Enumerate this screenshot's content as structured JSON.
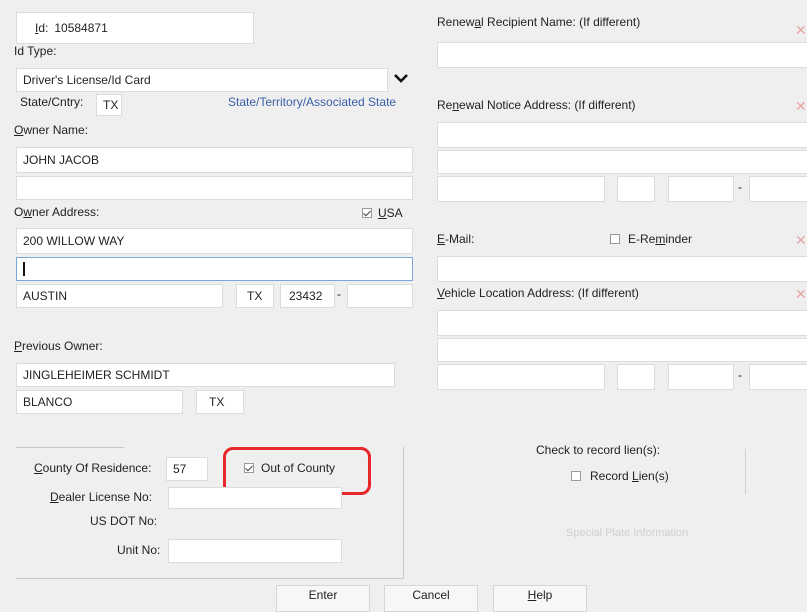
{
  "left": {
    "id_label": "Id:",
    "id_value": "10584871",
    "id_type_label": "Id Type:",
    "id_type_value": "Driver's License/Id Card",
    "state_label": "State/Cntry:",
    "state_value": "TX",
    "state_link": "State/Territory/Associated State",
    "owner_name_label": "Owner Name:",
    "owner_name_1": "JOHN JACOB",
    "owner_name_2": "",
    "owner_address_label": "Owner Address:",
    "usa_label": "USA",
    "address_1": "200 WILLOW WAY",
    "address_2": "",
    "city": "AUSTIN",
    "addr_state": "TX",
    "zip": "23432",
    "zip_sep": "-",
    "zip_ext": "",
    "previous_owner_label": "Previous Owner:",
    "previous_owner_name": "JINGLEHEIMER SCHMIDT",
    "previous_owner_city": "BLANCO",
    "previous_owner_state": "TX"
  },
  "right": {
    "renewal_recipient_label": "Renewal Recipient Name: (If different)",
    "renewal_notice_label": "Renewal Notice Address: (If different)",
    "zip_sep": "-",
    "email_label": "E-Mail:",
    "ereminder_label": "E-Reminder",
    "vehicle_location_label": "Vehicle Location Address: (If different)",
    "zip_sep2": "-",
    "lien_header": "Check to record lien(s):",
    "lien_label": "Record Lien(s)",
    "special_plate": "Special Plate Information",
    "x_mark": "✕"
  },
  "bottom": {
    "county_label": "County Of Residence:",
    "county_value": "57",
    "out_of_county_label": "Out of County",
    "dealer_label": "Dealer License No:",
    "usdot_label": "US DOT No:",
    "unit_label": "Unit No:"
  },
  "buttons": {
    "enter": "Enter",
    "cancel": "Cancel",
    "help": "Help"
  },
  "colors": {
    "highlight": "#e8262b",
    "link": "#3a5fa8"
  }
}
